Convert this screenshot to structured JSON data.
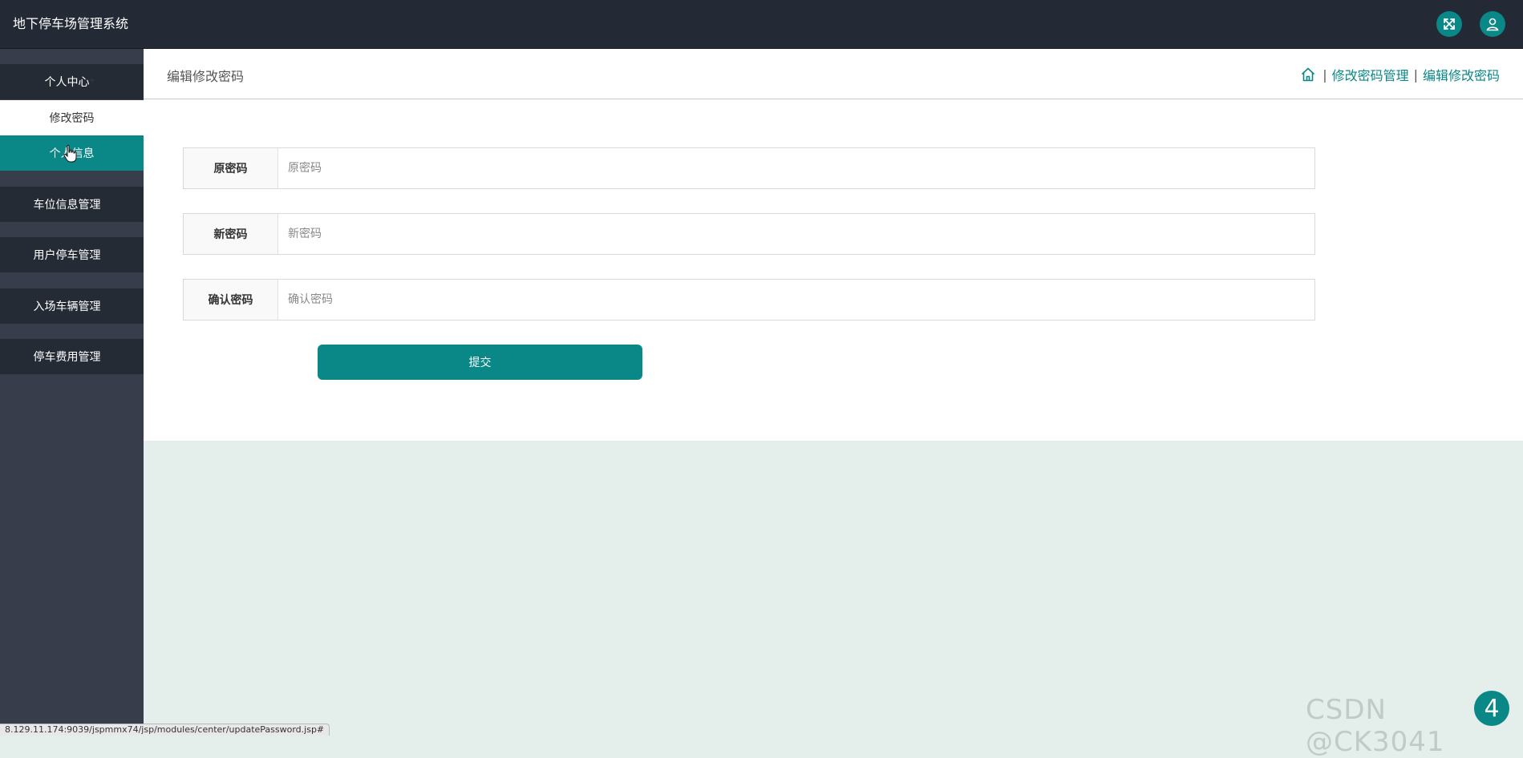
{
  "header": {
    "app_title": "地下停车场管理系统"
  },
  "sidebar": {
    "groups": [
      {
        "label": "个人中心",
        "items": [
          {
            "label": "修改密码"
          },
          {
            "label": "个人信息"
          }
        ]
      },
      {
        "label": "车位信息管理"
      },
      {
        "label": "用户停车管理"
      },
      {
        "label": "入场车辆管理"
      },
      {
        "label": "停车费用管理"
      }
    ]
  },
  "content": {
    "page_title": "编辑修改密码",
    "breadcrumb": [
      "修改密码管理",
      "编辑修改密码"
    ],
    "breadcrumb_separator": "|",
    "form": {
      "fields": [
        {
          "label": "原密码",
          "placeholder": "原密码",
          "value": ""
        },
        {
          "label": "新密码",
          "placeholder": "新密码",
          "value": ""
        },
        {
          "label": "确认密码",
          "placeholder": "确认密码",
          "value": ""
        }
      ],
      "submit_label": "提交"
    }
  },
  "status_bar": {
    "url": "8.129.11.174:9039/jspmmx74/jsp/modules/center/updatePassword.jsp#"
  },
  "watermark": "CSDN @CK3041",
  "float_badge": "4",
  "colors": {
    "accent": "#0a8787",
    "topbar": "#232a35",
    "sidebar": "#373d4a",
    "page_bg": "#e4efeb"
  },
  "icons": {
    "fullscreen": "fullscreen-icon",
    "user": "user-icon",
    "home": "home-icon",
    "cursor": "hand-cursor-icon"
  }
}
